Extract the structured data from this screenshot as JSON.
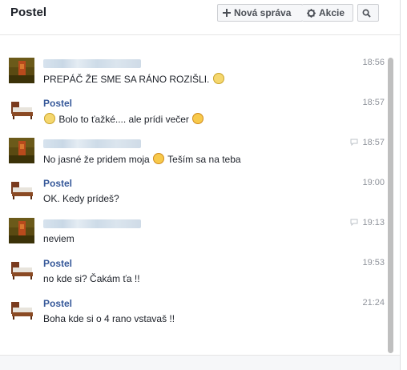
{
  "header": {
    "title": "Postel",
    "new_message_label": "Nová správa",
    "actions_label": "Akcie"
  },
  "icons": {
    "new_message": "plus-icon",
    "actions": "gear-icon",
    "search": "search-icon",
    "seen": "speech-bubble-icon"
  },
  "colors": {
    "name": "#365899",
    "time": "#90949c",
    "text": "#1d2129"
  },
  "messages": [
    {
      "sender": "",
      "avatar": "person",
      "time": "18:56",
      "seen": false,
      "parts": [
        "PREPÁČ  ŽE SME SA RÁNO ROZIŠLI. ",
        ""
      ],
      "emoji": "frown"
    },
    {
      "sender": "Postel",
      "avatar": "bed",
      "time": "18:57",
      "seen": false,
      "parts": [
        "",
        " Bolo to ťažké.... ale prídi večer "
      ],
      "emoji": "frown,wink"
    },
    {
      "sender": "",
      "avatar": "person",
      "time": "18:57",
      "seen": true,
      "parts": [
        "No jasné že pridem moja ",
        " Teším sa na teba"
      ],
      "emoji": "smile"
    },
    {
      "sender": "Postel",
      "avatar": "bed",
      "time": "19:00",
      "seen": false,
      "parts": [
        "OK. Kedy prídeš?",
        ""
      ],
      "emoji": ""
    },
    {
      "sender": "",
      "avatar": "person",
      "time": "19:13",
      "seen": true,
      "parts": [
        "neviem",
        ""
      ],
      "emoji": ""
    },
    {
      "sender": "Postel",
      "avatar": "bed",
      "time": "19:53",
      "seen": false,
      "parts": [
        "no kde si? Čakám ťa !!",
        ""
      ],
      "emoji": ""
    },
    {
      "sender": "Postel",
      "avatar": "bed",
      "time": "21:24",
      "seen": false,
      "parts": [
        "Boha kde si o 4 rano vstavaš !!",
        ""
      ],
      "emoji": ""
    }
  ]
}
